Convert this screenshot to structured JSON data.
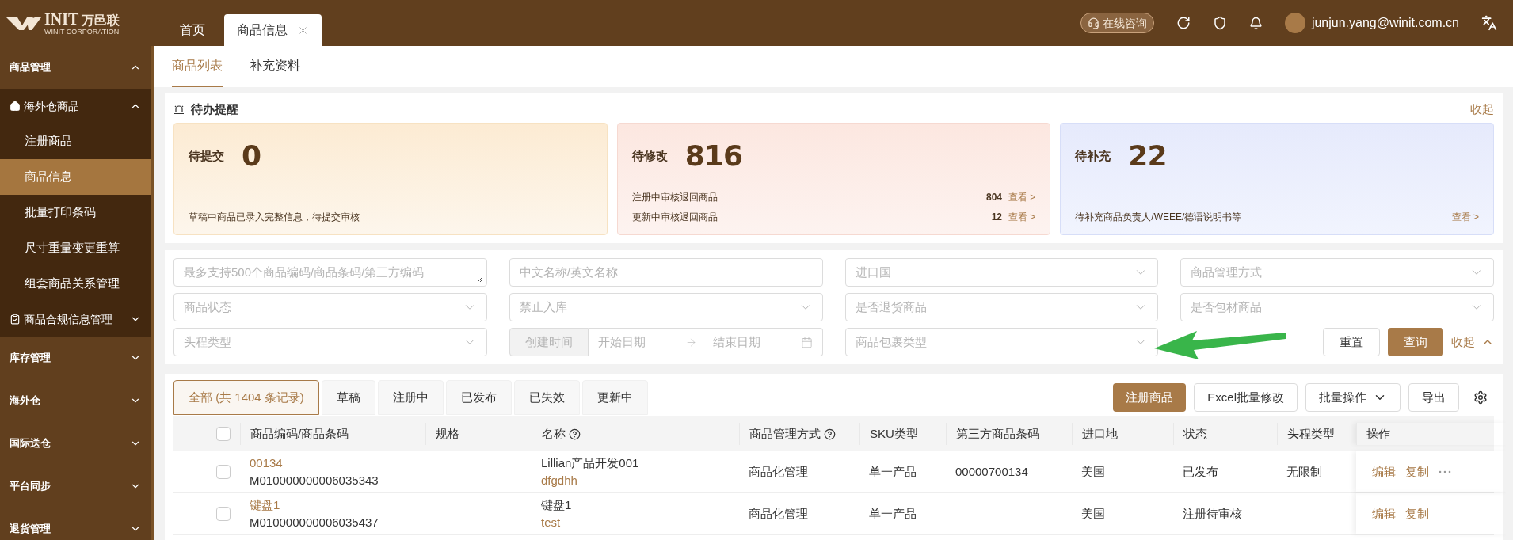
{
  "logo": {
    "brand": "INIT",
    "cn": "万邑联",
    "sub": "WINIT CORPORATION"
  },
  "nav_tabs": [
    {
      "label": "首页",
      "selected": false,
      "closable": false
    },
    {
      "label": "商品信息",
      "selected": true,
      "closable": true
    }
  ],
  "header": {
    "consult": "在线咨询",
    "user": "junjun.yang@winit.com.cn"
  },
  "sidebar": {
    "items": [
      {
        "label": "商品管理",
        "expanded": true,
        "children": [
          {
            "label": "海外仓商品",
            "kind": "home",
            "expanded": true,
            "children": [
              {
                "label": "注册商品",
                "selected": false
              },
              {
                "label": "商品信息",
                "selected": true
              },
              {
                "label": "批量打印条码",
                "selected": false
              },
              {
                "label": "尺寸重量变更重算",
                "selected": false
              },
              {
                "label": "组套商品关系管理",
                "selected": false
              }
            ]
          },
          {
            "label": "商品合规信息管理",
            "kind": "clipboard",
            "expanded": false
          }
        ]
      },
      {
        "label": "库存管理",
        "expanded": false
      },
      {
        "label": "海外仓",
        "expanded": false
      },
      {
        "label": "国际送仓",
        "expanded": false
      },
      {
        "label": "平台同步",
        "expanded": false
      },
      {
        "label": "退货管理",
        "expanded": false
      }
    ]
  },
  "sub_tabs": [
    {
      "label": "商品列表",
      "selected": true
    },
    {
      "label": "补充资料",
      "selected": false
    }
  ],
  "todo": {
    "title": "待办提醒",
    "collapse": "收起",
    "cards": [
      {
        "kind": "warn",
        "title": "待提交",
        "count": "0",
        "lines": [
          {
            "text": "草稿中商品已录入完整信息，待提交审核"
          }
        ]
      },
      {
        "kind": "error",
        "title": "待修改",
        "count": "816",
        "lines": [
          {
            "text": "注册中审核退回商品",
            "count": "804",
            "link": "查看 >"
          },
          {
            "text": "更新中审核退回商品",
            "count": "12",
            "link": "查看 >"
          }
        ]
      },
      {
        "kind": "info",
        "title": "待补充",
        "count": "22",
        "lines": [
          {
            "text": "待补充商品负责人/WEEE/德语说明书等",
            "link": "查看 >"
          }
        ]
      }
    ]
  },
  "filters": [
    {
      "kind": "textarea",
      "placeholder": "最多支持500个商品编码/商品条码/第三方编码"
    },
    {
      "kind": "input",
      "placeholder": "中文名称/英文名称"
    },
    {
      "kind": "select",
      "placeholder": "进口国"
    },
    {
      "kind": "select",
      "placeholder": "商品管理方式"
    },
    {
      "kind": "select",
      "placeholder": "商品状态"
    },
    {
      "kind": "select",
      "placeholder": "禁止入库"
    },
    {
      "kind": "select",
      "placeholder": "是否退货商品"
    },
    {
      "kind": "select",
      "placeholder": "是否包材商品"
    },
    {
      "kind": "select",
      "placeholder": "头程类型"
    },
    {
      "kind": "daterange",
      "label": "创建时间",
      "start": "开始日期",
      "end": "结束日期"
    },
    {
      "kind": "select",
      "placeholder": "商品包裹类型"
    }
  ],
  "filter_actions": {
    "reset": "重置",
    "query": "查询",
    "collapse": "收起"
  },
  "status_tabs": [
    {
      "label": "全部 (共 1404 条记录)",
      "selected": true
    },
    {
      "label": "草稿",
      "selected": false
    },
    {
      "label": "注册中",
      "selected": false
    },
    {
      "label": "已发布",
      "selected": false
    },
    {
      "label": "已失效",
      "selected": false
    },
    {
      "label": "更新中",
      "selected": false
    }
  ],
  "toolbar": {
    "register": "注册商品",
    "excel": "Excel批量修改",
    "batch": "批量操作",
    "export": "导出"
  },
  "table": {
    "select_all_checked": false,
    "columns": [
      {
        "label": "商品编码/商品条码",
        "kind": "plain"
      },
      {
        "label": "规格",
        "kind": "plain"
      },
      {
        "label": "名称",
        "kind": "help"
      },
      {
        "label": "商品管理方式",
        "kind": "help"
      },
      {
        "label": "SKU类型",
        "kind": "plain"
      },
      {
        "label": "第三方商品条码",
        "kind": "plain"
      },
      {
        "label": "进口地",
        "kind": "plain"
      },
      {
        "label": "状态",
        "kind": "plain"
      },
      {
        "label": "头程类型",
        "kind": "plain"
      },
      {
        "label": "操作",
        "kind": "plain"
      }
    ],
    "rows": [
      {
        "checked": false,
        "code": "00134",
        "barcode": "M010000000006035343",
        "name": "Lillian产品开发001",
        "name_sub": "dfgdhh",
        "mgmt": "商品化管理",
        "sku": "单一产品",
        "third": "00000700134",
        "origin": "美国",
        "status": "已发布",
        "head": "无限制",
        "actions": [
          {
            "kind": "link",
            "label": "编辑"
          },
          {
            "kind": "link",
            "label": "复制"
          },
          {
            "kind": "more"
          }
        ]
      },
      {
        "checked": false,
        "code": "键盘1",
        "barcode": "M010000000006035437",
        "name": "键盘1",
        "name_sub": "test",
        "mgmt": "商品化管理",
        "sku": "单一产品",
        "origin": "美国",
        "status": "注册待审核",
        "actions": [
          {
            "kind": "link",
            "label": "编辑"
          },
          {
            "kind": "link",
            "label": "复制"
          }
        ]
      }
    ]
  }
}
